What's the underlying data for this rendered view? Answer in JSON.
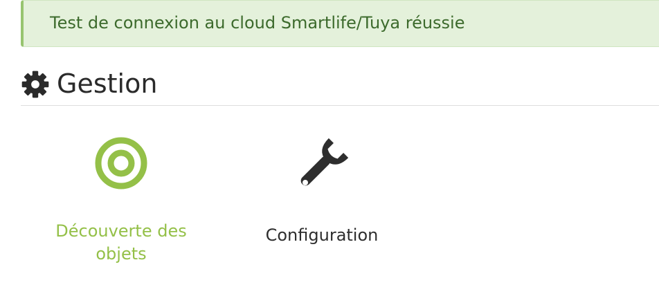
{
  "alert": {
    "message": "Test de connexion au cloud Smartlife/Tuya réussie"
  },
  "management": {
    "title": "Gestion",
    "icon": "gear-icon",
    "items": [
      {
        "label": "Découverte des objets",
        "icon": "target-icon",
        "color": "#94c048"
      },
      {
        "label": "Configuration",
        "icon": "wrench-icon",
        "color": "#2e2e2e"
      }
    ]
  },
  "colors": {
    "success_bg": "#e4f1db",
    "success_border": "#97c46f",
    "success_text": "#3c6a2c",
    "accent": "#94c048"
  }
}
